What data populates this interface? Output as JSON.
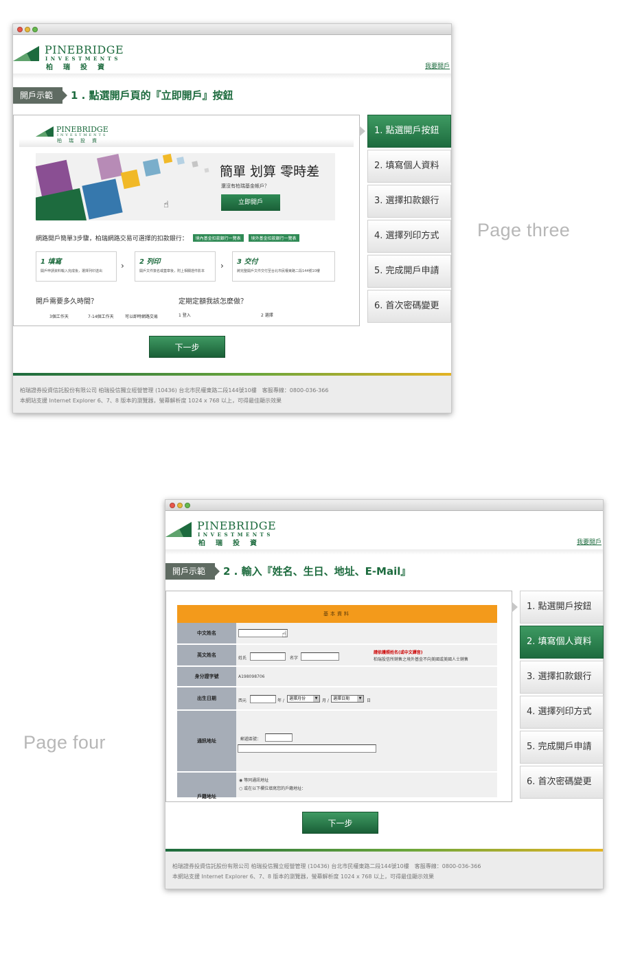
{
  "shared": {
    "brand": "PINEBRIDGE",
    "brand_sub": "INVESTMENTS",
    "brand_cn": "柏瑞投資",
    "open_link": "我要開戶",
    "demo_badge": "開戶示範",
    "next_button": "下一步",
    "footer_line1": "柏瑞證券投資信託股份有限公司 柏瑞投信獨立經營管理 (10436) 台北市民權東路二段144號10樓　客服專線：0800-036-366",
    "footer_line2": "本網站支援 Internet Explorer 6、7、8 版本的瀏覽器，螢幕解析度 1024 x 768 以上，可得最佳顯示效果",
    "steps": [
      "1. 點選開戶按鈕",
      "2. 填寫個人資料",
      "3. 選擇扣款銀行",
      "4. 選擇列印方式",
      "5. 完成開戶申請",
      "6. 首次密碼變更"
    ],
    "colors": {
      "brand_green": "#1d6b3e",
      "accent_orange": "#f39a1b"
    }
  },
  "page3": {
    "label": "Page three",
    "step_title": "1 . 點選開戶頁的『立即開戶』按鈕",
    "active_step": 0,
    "banner": {
      "title": "簡單 划算 零時差",
      "subtitle": "還沒有柏瑞基金帳戶？",
      "button": "立即開戶"
    },
    "intro": "網路開戶簡單3步驟，柏瑞網路交易可選擇的扣款銀行：",
    "tags": [
      "境內基金扣款銀行一覽表",
      "境外基金扣款銀行一覽表"
    ],
    "step_boxes": [
      {
        "n": "1 填寫",
        "d": "開戶申請資料輸入完成後，選擇列印送出"
      },
      {
        "n": "2 列印",
        "d": "開戶文件簽名或蓋章後，附上相關證件影本"
      },
      {
        "n": "3 交付",
        "d": "將完整開戶文件交付至台北市民權東路二段144號10樓"
      }
    ],
    "questions": [
      "開戶需要多久時間？",
      "定期定額我該怎麼做？"
    ],
    "tiny": [
      "3個工作天",
      "7-14個工作天",
      "可以即時網路交易",
      "1 登入",
      "2 選擇"
    ]
  },
  "page4": {
    "label": "Page four",
    "step_title": "2 . 輸入『姓名、生日、地址、E-Mail』",
    "active_step": 1,
    "form": {
      "header": "基本資料",
      "labels": [
        "中文姓名",
        "英文姓名",
        "身分證字號",
        "出生日期",
        "通訊地址",
        "戶籍地址"
      ],
      "surname": "姓氏",
      "given": "名字",
      "warn": "請依護照姓名(或中文譯音)",
      "note": "柏瑞投信所銷售之境外基金不向美國或美國人士銷售",
      "id_value": "A198098706",
      "era": "西元",
      "year": "年 /",
      "month_select": "選擇月份",
      "month": "月 /",
      "day_select": "選擇日期",
      "day": "日",
      "zip_label": "郵遞區號：",
      "radio1": "等同通訊地址",
      "radio2": "或在以下欄位填寫您的戶籍地址："
    }
  }
}
